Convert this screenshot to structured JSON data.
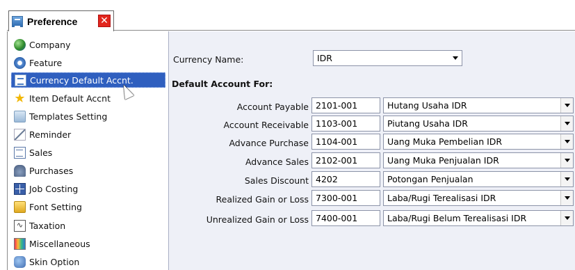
{
  "tab": {
    "title": "Preference",
    "icon": "preference-icon",
    "close_icon": "close-icon"
  },
  "sidebar": {
    "items": [
      {
        "label": "Company",
        "icon": "globe-icon"
      },
      {
        "label": "Feature",
        "icon": "gear-icon"
      },
      {
        "label": "Currency Default Accnt.",
        "icon": "currency-doc-icon",
        "active": true
      },
      {
        "label": "Item Default Accnt",
        "icon": "star-icon"
      },
      {
        "label": "Templates Setting",
        "icon": "templates-icon"
      },
      {
        "label": "Reminder",
        "icon": "reminder-icon"
      },
      {
        "label": "Sales",
        "icon": "sales-icon"
      },
      {
        "label": "Purchases",
        "icon": "purchases-icon"
      },
      {
        "label": "Job Costing",
        "icon": "job-costing-icon"
      },
      {
        "label": "Font Setting",
        "icon": "font-folder-icon"
      },
      {
        "label": "Taxation",
        "icon": "taxation-icon"
      },
      {
        "label": "Miscellaneous",
        "icon": "miscellaneous-icon"
      },
      {
        "label": "Skin Option",
        "icon": "skin-icon"
      }
    ]
  },
  "main": {
    "currency_label": "Currency Name:",
    "currency_value": "IDR",
    "section_title": "Default Account For:",
    "rows": [
      {
        "label": "Account Payable",
        "code": "2101-001",
        "account": "Hutang Usaha IDR"
      },
      {
        "label": "Account Receivable",
        "code": "1103-001",
        "account": "Piutang Usaha IDR"
      },
      {
        "label": "Advance Purchase",
        "code": "1104-001",
        "account": "Uang Muka Pembelian IDR"
      },
      {
        "label": "Advance Sales",
        "code": "2102-001",
        "account": "Uang Muka Penjualan IDR"
      },
      {
        "label": "Sales Discount",
        "code": "4202",
        "account": "Potongan Penjualan"
      },
      {
        "label": "Realized Gain or Loss",
        "code": "7300-001",
        "account": "Laba/Rugi Terealisasi IDR"
      },
      {
        "label": "Unrealized Gain or Loss",
        "code": "7400-001",
        "account": "Laba/Rugi Belum Terealisasi IDR"
      }
    ]
  },
  "colors": {
    "selection": "#2f5fbf",
    "panel_bg": "#eef0f7",
    "close_red": "#e2261d"
  }
}
